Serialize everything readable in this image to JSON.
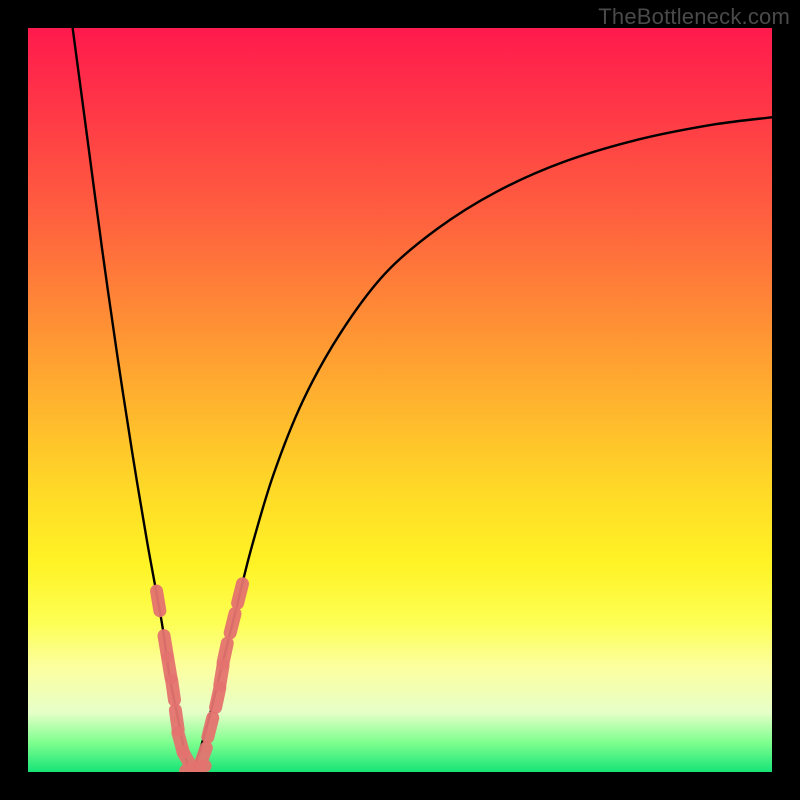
{
  "watermark": "TheBottleneck.com",
  "colors": {
    "frame": "#000000",
    "curve": "#000000",
    "marker_fill": "#e4736f",
    "marker_stroke": "#d15853"
  },
  "chart_data": {
    "type": "line",
    "title": "",
    "xlabel": "",
    "ylabel": "",
    "xlim": [
      0,
      100
    ],
    "ylim": [
      0,
      100
    ],
    "note": "V-shaped bottleneck curve; y = deviation from optimal (0 = green/no bottleneck, 100 = red/severe). Minimum near x≈22. Axes have no visible ticks.",
    "series": [
      {
        "name": "left-branch",
        "x": [
          6,
          8,
          10,
          12,
          14,
          16,
          18,
          19,
          20,
          21,
          22
        ],
        "y": [
          100,
          85,
          70,
          56,
          43,
          31,
          20,
          13,
          8,
          3,
          0
        ]
      },
      {
        "name": "right-branch",
        "x": [
          22,
          24,
          26,
          28,
          30,
          33,
          37,
          42,
          48,
          55,
          63,
          72,
          82,
          92,
          100
        ],
        "y": [
          0,
          6,
          14,
          22,
          30,
          40,
          50,
          59,
          67,
          73,
          78,
          82,
          85,
          87,
          88
        ]
      }
    ],
    "markers": {
      "name": "highlighted-points",
      "note": "Salmon capsule/blob markers clustered around the trough of the V.",
      "points": [
        {
          "x": 17.5,
          "y": 23
        },
        {
          "x": 18.5,
          "y": 17
        },
        {
          "x": 19.0,
          "y": 14
        },
        {
          "x": 19.5,
          "y": 11
        },
        {
          "x": 20.0,
          "y": 7
        },
        {
          "x": 20.5,
          "y": 4
        },
        {
          "x": 21.5,
          "y": 1.5
        },
        {
          "x": 22.5,
          "y": 0.5
        },
        {
          "x": 23.5,
          "y": 2
        },
        {
          "x": 24.5,
          "y": 6
        },
        {
          "x": 25.5,
          "y": 10
        },
        {
          "x": 26.0,
          "y": 13
        },
        {
          "x": 26.5,
          "y": 16
        },
        {
          "x": 27.5,
          "y": 20
        },
        {
          "x": 28.5,
          "y": 24
        }
      ]
    }
  }
}
